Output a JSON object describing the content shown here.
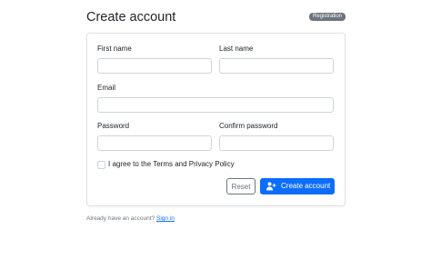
{
  "header": {
    "title": "Create account",
    "badge": "Registration"
  },
  "form": {
    "first_name": {
      "label": "First name",
      "value": "",
      "placeholder": ""
    },
    "last_name": {
      "label": "Last name",
      "value": "",
      "placeholder": ""
    },
    "email": {
      "label": "Email",
      "value": "",
      "placeholder": ""
    },
    "password": {
      "label": "Password",
      "value": "",
      "placeholder": ""
    },
    "confirm_password": {
      "label": "Confirm password",
      "value": "",
      "placeholder": ""
    },
    "agree_label": "I agree to the Terms and Privacy Policy",
    "reset_label": "Reset",
    "create_label": "Create account"
  },
  "footer": {
    "text": "Already have an account?",
    "link": "Sign in"
  },
  "colors": {
    "primary": "#0d6efd",
    "secondary": "#6c757d",
    "border": "#ced4da"
  },
  "icons": {
    "create_button_icon": "user-plus-icon"
  }
}
